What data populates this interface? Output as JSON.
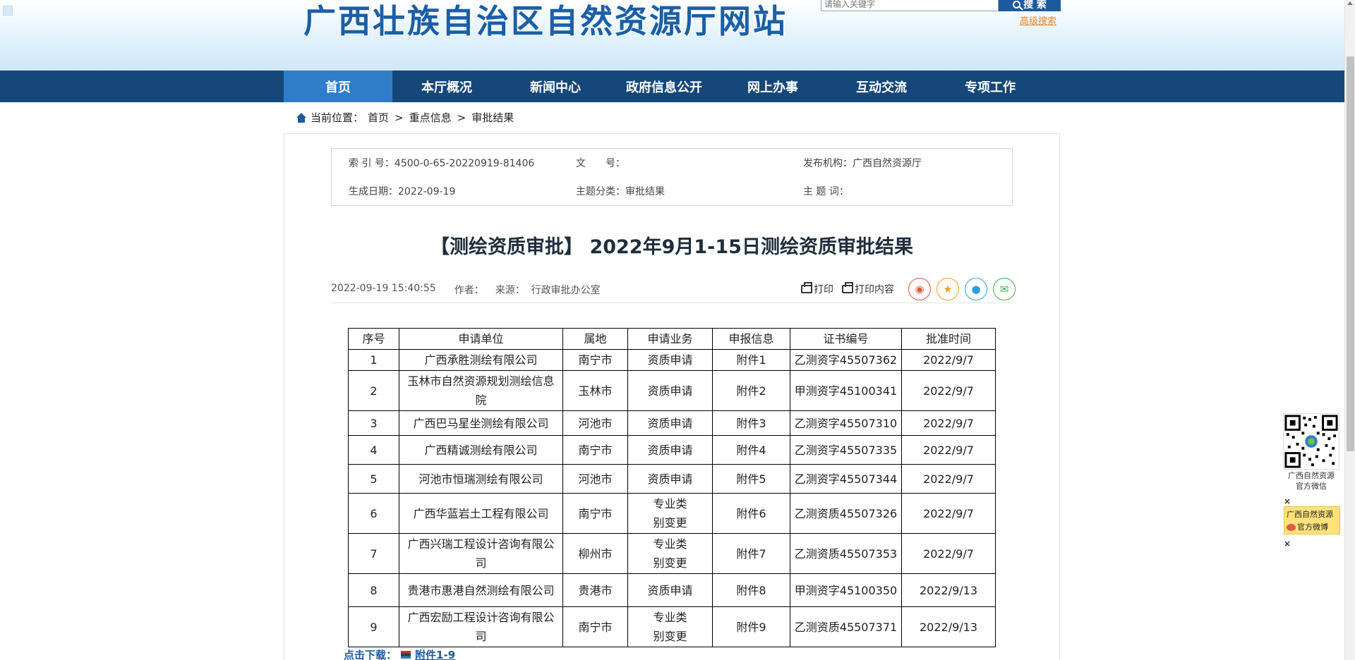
{
  "header": {
    "site_title": "广西壮族自治区自然资源厅网站",
    "search_placeholder": "请输入关键字",
    "search_button": "搜 索",
    "advanced_search": "高级搜索"
  },
  "nav": {
    "items": [
      "首页",
      "本厅概况",
      "新闻中心",
      "政府信息公开",
      "网上办事",
      "互动交流",
      "专项工作"
    ],
    "active_index": 0
  },
  "breadcrumb": {
    "label": "当前位置：",
    "items": [
      "首页",
      "重点信息",
      "审批结果"
    ],
    "separator": ">"
  },
  "meta": {
    "index_label": "索 引 号：",
    "index_value": "4500-0-65-20220919-81406",
    "doc_no_label": "文　　号：",
    "doc_no_value": "",
    "publisher_label": "发布机构：",
    "publisher_value": "广西自然资源厅",
    "date_label": "生成日期：",
    "date_value": "2022-09-19",
    "category_label": "主题分类：",
    "category_value": "审批结果",
    "keywords_label": "主 题 词：",
    "keywords_value": ""
  },
  "article": {
    "title": "【测绘资质审批】 2022年9月1-15日测绘资质审批结果",
    "datetime": "2022-09-19 15:40:55",
    "author_label": "作者：",
    "author_value": "",
    "source_label": "来源：",
    "source_value": "行政审批办公室",
    "print_label": "打印",
    "print_content_label": "打印内容"
  },
  "table": {
    "headers": [
      "序号",
      "申请单位",
      "属地",
      "申请业务",
      "申报信息",
      "证书编号",
      "批准时间"
    ],
    "rows": [
      [
        "1",
        "广西承胜测绘有限公司",
        "南宁市",
        "资质申请",
        "附件1",
        "乙测资字45507362",
        "2022/9/7"
      ],
      [
        "2",
        "玉林市自然资源规划测绘信息院",
        "玉林市",
        "资质申请",
        "附件2",
        "甲测资字45100341",
        "2022/9/7"
      ],
      [
        "3",
        "广西巴马星坐测绘有限公司",
        "河池市",
        "资质申请",
        "附件3",
        "乙测资字45507310",
        "2022/9/7"
      ],
      [
        "4",
        "广西精诚测绘有限公司",
        "南宁市",
        "资质申请",
        "附件4",
        "乙测资字45507335",
        "2022/9/7"
      ],
      [
        "5",
        "河池市恒瑞测绘有限公司",
        "河池市",
        "资质申请",
        "附件5",
        "乙测资字45507344",
        "2022/9/7"
      ],
      [
        "6",
        "广西华蓝岩土工程有限公司",
        "南宁市",
        "专业类别变更",
        "附件6",
        "乙测资质45507326",
        "2022/9/7"
      ],
      [
        "7",
        "广西兴瑞工程设计咨询有限公司",
        "柳州市",
        "专业类别变更",
        "附件7",
        "乙测资质45507353",
        "2022/9/7"
      ],
      [
        "8",
        "贵港市惠港自然测绘有限公司",
        "贵港市",
        "资质申请",
        "附件8",
        "甲测资字45100350",
        "2022/9/13"
      ],
      [
        "9",
        "广西宏励工程设计咨询有限公司",
        "南宁市",
        "专业类别变更",
        "附件9",
        "乙测资质45507371",
        "2022/9/13"
      ]
    ]
  },
  "download": {
    "label": "点击下载：",
    "link": "附件1-9"
  },
  "side_widgets": {
    "wechat_label_1": "广西自然资源",
    "wechat_label_2": "官方微信",
    "weibo_label_1": "广西自然资源",
    "weibo_label_2": "官方微博",
    "close": "×"
  },
  "colors": {
    "nav_bg": "#16477a",
    "nav_active": "#2f7cc8",
    "title_blue": "#1b5fa6",
    "link_orange": "#e8872a"
  }
}
